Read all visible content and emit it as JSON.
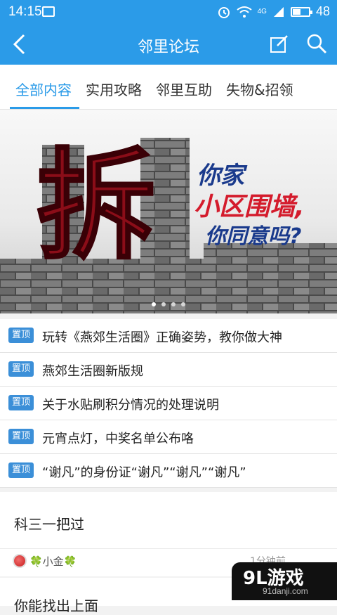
{
  "status_bar": {
    "time": "14:15",
    "network": "4G",
    "battery": "48",
    "battery_fraction": 0.48,
    "icons": [
      "image-icon",
      "alarm-icon",
      "wifi-icon",
      "signal-icon",
      "battery-icon"
    ]
  },
  "header": {
    "title": "邻里论坛",
    "icons": [
      "back-icon",
      "edit-icon",
      "search-icon"
    ]
  },
  "tabs": [
    {
      "label": "全部内容",
      "active": true
    },
    {
      "label": "实用攻略",
      "active": false
    },
    {
      "label": "邻里互助",
      "active": false
    },
    {
      "label": "失物&招领",
      "active": false
    }
  ],
  "banner": {
    "big_char": "拆",
    "line1": "你家",
    "line2": "小区围墙,",
    "line3": "你同意吗?",
    "slide_count": 4,
    "active_slide": 0
  },
  "notices": [
    {
      "tag": "置顶",
      "text": "玩转《燕郊生活圈》正确姿势，教你做大神"
    },
    {
      "tag": "置顶",
      "text": "燕郊生活圈新版规"
    },
    {
      "tag": "置顶",
      "text": "关于水贴刷积分情况的处理说明"
    },
    {
      "tag": "置顶",
      "text": "元宵点灯，中奖名单公布咯"
    },
    {
      "tag": "置顶",
      "text": "“谢凡”的身份证“谢凡”“谢凡”“谢凡”"
    }
  ],
  "posts": [
    {
      "title": "科三一把过",
      "user": "🍀小金🍀",
      "time": "1分钟前"
    }
  ],
  "next_post": {
    "title": "你能找出上面"
  },
  "watermark": {
    "brand": "9L游戏",
    "site": "91danji.com"
  },
  "colors": {
    "primary": "#2b9be8",
    "tag": "#3b8fd8",
    "banner_red": "#c8102e",
    "banner_blue": "#1a3a8c"
  }
}
